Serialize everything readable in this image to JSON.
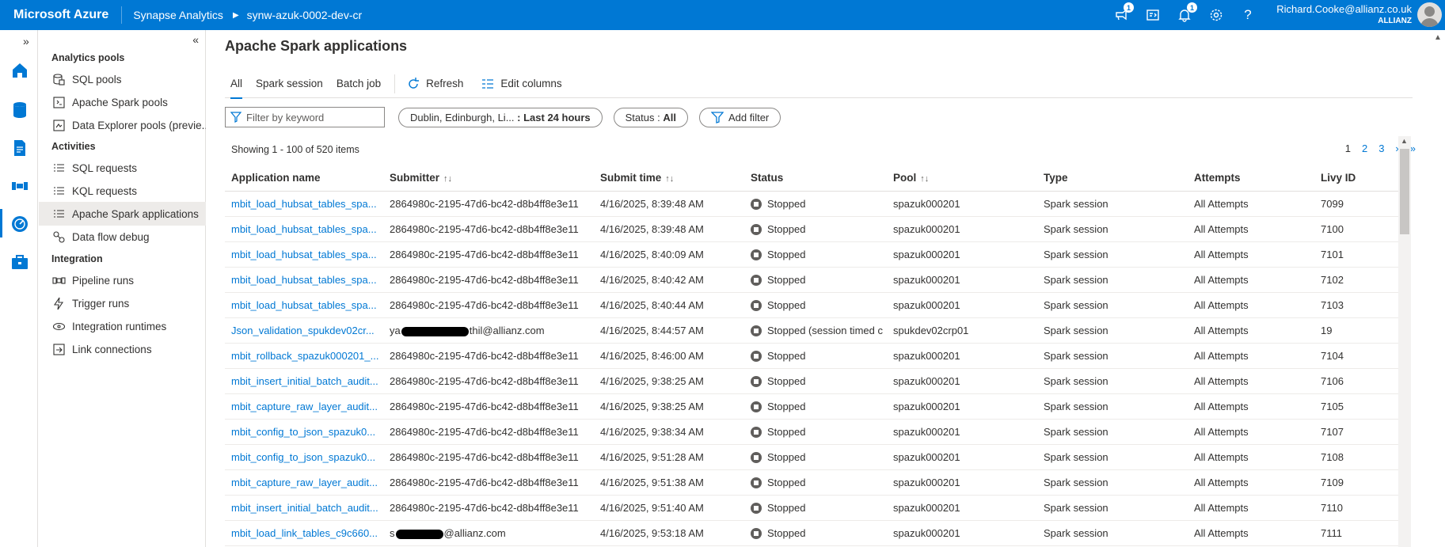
{
  "topbar": {
    "brand": "Microsoft Azure",
    "service": "Synapse Analytics",
    "workspace": "synw-azuk-0002-dev-cr",
    "feedback_badge": "1",
    "notifications_badge": "1",
    "user_email": "Richard.Cooke@allianz.co.uk",
    "user_org": "ALLIANZ",
    "accent_color": "#0078d4"
  },
  "rail": {
    "expand_glyph": "»",
    "icons": [
      "home-icon",
      "data-icon",
      "develop-icon",
      "integrate-icon",
      "monitor-icon",
      "manage-icon"
    ]
  },
  "nav": {
    "collapse_glyph": "«",
    "sections": {
      "analytics": "Analytics pools",
      "activities": "Activities",
      "integration": "Integration"
    },
    "items": {
      "sql_pools": "SQL pools",
      "spark_pools": "Apache Spark pools",
      "data_explorer": "Data Explorer pools (previe...",
      "sql_requests": "SQL requests",
      "kql_requests": "KQL requests",
      "spark_apps": "Apache Spark applications",
      "data_flow_debug": "Data flow debug",
      "pipeline_runs": "Pipeline runs",
      "trigger_runs": "Trigger runs",
      "integration_runtimes": "Integration runtimes",
      "link_connections": "Link connections"
    }
  },
  "main": {
    "title": "Apache Spark applications",
    "tabs": {
      "all": "All",
      "spark_session": "Spark session",
      "batch_job": "Batch job"
    },
    "toolbar": {
      "refresh": "Refresh",
      "edit_columns": "Edit columns"
    },
    "filter": {
      "keyword_placeholder": "Filter by keyword",
      "timezone": "Dublin, Edinburgh, Li...",
      "time_range": ": Last 24 hours",
      "status_label": "Status :",
      "status_value": "All",
      "add_filter": "Add filter"
    },
    "showing": "Showing 1 - 100 of 520 items",
    "pager": {
      "p1": "1",
      "p2": "2",
      "p3": "3",
      "next": "›",
      "last": "»"
    },
    "columns": {
      "app_name": "Application name",
      "submitter": "Submitter",
      "submit_time": "Submit time",
      "status": "Status",
      "pool": "Pool",
      "type": "Type",
      "attempts": "Attempts",
      "livy_id": "Livy ID"
    },
    "rows": [
      {
        "name": "mbit_load_hubsat_tables_spa...",
        "submitter": "2864980c-2195-47d6-bc42-d8b4ff8e3e11",
        "time": "4/16/2025, 8:39:48 AM",
        "status": "Stopped",
        "pool": "spazuk000201",
        "type": "Spark session",
        "attempts": "All Attempts",
        "livy": "7099"
      },
      {
        "name": "mbit_load_hubsat_tables_spa...",
        "submitter": "2864980c-2195-47d6-bc42-d8b4ff8e3e11",
        "time": "4/16/2025, 8:39:48 AM",
        "status": "Stopped",
        "pool": "spazuk000201",
        "type": "Spark session",
        "attempts": "All Attempts",
        "livy": "7100"
      },
      {
        "name": "mbit_load_hubsat_tables_spa...",
        "submitter": "2864980c-2195-47d6-bc42-d8b4ff8e3e11",
        "time": "4/16/2025, 8:40:09 AM",
        "status": "Stopped",
        "pool": "spazuk000201",
        "type": "Spark session",
        "attempts": "All Attempts",
        "livy": "7101"
      },
      {
        "name": "mbit_load_hubsat_tables_spa...",
        "submitter": "2864980c-2195-47d6-bc42-d8b4ff8e3e11",
        "time": "4/16/2025, 8:40:42 AM",
        "status": "Stopped",
        "pool": "spazuk000201",
        "type": "Spark session",
        "attempts": "All Attempts",
        "livy": "7102"
      },
      {
        "name": "mbit_load_hubsat_tables_spa...",
        "submitter": "2864980c-2195-47d6-bc42-d8b4ff8e3e11",
        "time": "4/16/2025, 8:40:44 AM",
        "status": "Stopped",
        "pool": "spazuk000201",
        "type": "Spark session",
        "attempts": "All Attempts",
        "livy": "7103"
      },
      {
        "name": "Json_validation_spukdev02cr...",
        "submitter_prefix": "ya",
        "submitter_suffix": "thil@allianz.com",
        "time": "4/16/2025, 8:44:57 AM",
        "status": "Stopped (session timed c",
        "pool": "spukdev02crp01",
        "type": "Spark session",
        "attempts": "All Attempts",
        "livy": "19"
      },
      {
        "name": "mbit_rollback_spazuk000201_...",
        "submitter": "2864980c-2195-47d6-bc42-d8b4ff8e3e11",
        "time": "4/16/2025, 8:46:00 AM",
        "status": "Stopped",
        "pool": "spazuk000201",
        "type": "Spark session",
        "attempts": "All Attempts",
        "livy": "7104"
      },
      {
        "name": "mbit_insert_initial_batch_audit...",
        "submitter": "2864980c-2195-47d6-bc42-d8b4ff8e3e11",
        "time": "4/16/2025, 9:38:25 AM",
        "status": "Stopped",
        "pool": "spazuk000201",
        "type": "Spark session",
        "attempts": "All Attempts",
        "livy": "7106"
      },
      {
        "name": "mbit_capture_raw_layer_audit...",
        "submitter": "2864980c-2195-47d6-bc42-d8b4ff8e3e11",
        "time": "4/16/2025, 9:38:25 AM",
        "status": "Stopped",
        "pool": "spazuk000201",
        "type": "Spark session",
        "attempts": "All Attempts",
        "livy": "7105"
      },
      {
        "name": "mbit_config_to_json_spazuk0...",
        "submitter": "2864980c-2195-47d6-bc42-d8b4ff8e3e11",
        "time": "4/16/2025, 9:38:34 AM",
        "status": "Stopped",
        "pool": "spazuk000201",
        "type": "Spark session",
        "attempts": "All Attempts",
        "livy": "7107"
      },
      {
        "name": "mbit_config_to_json_spazuk0...",
        "submitter": "2864980c-2195-47d6-bc42-d8b4ff8e3e11",
        "time": "4/16/2025, 9:51:28 AM",
        "status": "Stopped",
        "pool": "spazuk000201",
        "type": "Spark session",
        "attempts": "All Attempts",
        "livy": "7108"
      },
      {
        "name": "mbit_capture_raw_layer_audit...",
        "submitter": "2864980c-2195-47d6-bc42-d8b4ff8e3e11",
        "time": "4/16/2025, 9:51:38 AM",
        "status": "Stopped",
        "pool": "spazuk000201",
        "type": "Spark session",
        "attempts": "All Attempts",
        "livy": "7109"
      },
      {
        "name": "mbit_insert_initial_batch_audit...",
        "submitter": "2864980c-2195-47d6-bc42-d8b4ff8e3e11",
        "time": "4/16/2025, 9:51:40 AM",
        "status": "Stopped",
        "pool": "spazuk000201",
        "type": "Spark session",
        "attempts": "All Attempts",
        "livy": "7110"
      },
      {
        "name": "mbit_load_link_tables_c9c660...",
        "submitter_prefix": "s",
        "submitter_suffix": "@allianz.com",
        "time": "4/16/2025, 9:53:18 AM",
        "status": "Stopped",
        "pool": "spazuk000201",
        "type": "Spark session",
        "attempts": "All Attempts",
        "livy": "7111"
      }
    ]
  }
}
